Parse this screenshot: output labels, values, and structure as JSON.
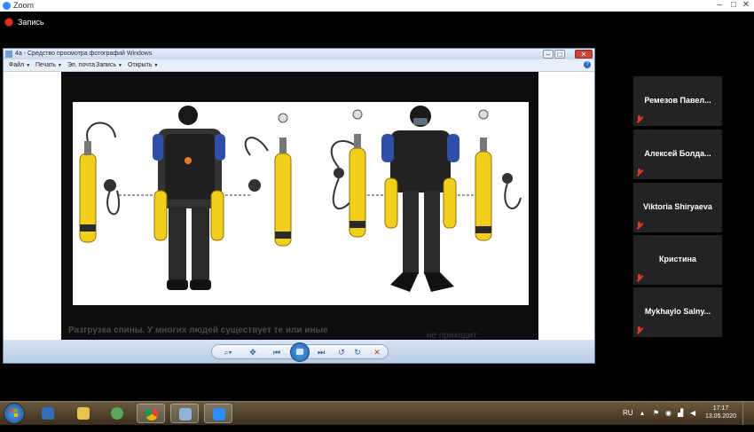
{
  "zoom": {
    "title": "Zoom",
    "recording_label": "Запись"
  },
  "viewer": {
    "title": "4a - Средство просмотра фотографий Windows",
    "menu": [
      {
        "label": "Файл"
      },
      {
        "label": "Печать"
      },
      {
        "label": "Эл. почта"
      },
      {
        "label": "Запись"
      },
      {
        "label": "Открыть"
      }
    ],
    "slide_caption": "Разгрузка спины. У многих людей существует те или иные",
    "slide_caption_right": "не приходит"
  },
  "participants": [
    {
      "name": "Ремезов Павел..."
    },
    {
      "name": "Алексей Болда..."
    },
    {
      "name": "Viktoria Shiryaeva"
    },
    {
      "name": "Кристина"
    },
    {
      "name": "Mykhaylo Salny..."
    }
  ],
  "taskbar": {
    "language": "RU",
    "time": "17:17",
    "date": "13.05.2020"
  },
  "colors": {
    "viewer_frame": "#dfe8f4",
    "participant_tile": "#232323",
    "mute_red": "#e23a2b",
    "tank_yellow": "#f2cf1d"
  }
}
